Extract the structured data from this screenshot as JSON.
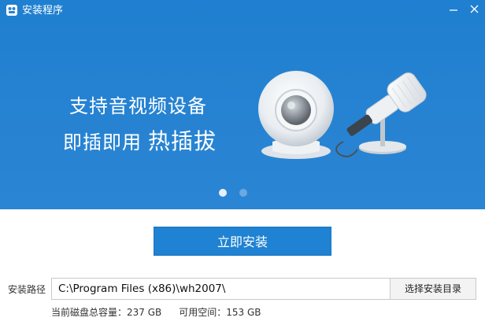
{
  "window": {
    "title": "安装程序",
    "icon": "installer-app-icon",
    "minimize_icon": "minimize-icon",
    "close_icon": "close-icon"
  },
  "banner": {
    "slogan_line1": "支持音视频设备",
    "slogan_line2_part1": "即插即用",
    "slogan_line2_part2": "热插拔",
    "illustration": "webcam-and-microphone-illustration",
    "carousel_dots": 2,
    "carousel_active_index": 0,
    "colors": {
      "background": "#2783d2",
      "dot_active": "#e7f0fa",
      "dot_inactive": "#6aa9e2"
    }
  },
  "install_button": {
    "label": "立即安装",
    "color": "#1f82d2"
  },
  "install_path": {
    "label": "安装路径",
    "value": "C:\\Program Files (x86)\\wh2007\\",
    "browse_label": "选择安装目录"
  },
  "disk": {
    "total_label": "当前磁盘总容量：237 GB",
    "free_label": "可用空间：153 GB"
  }
}
